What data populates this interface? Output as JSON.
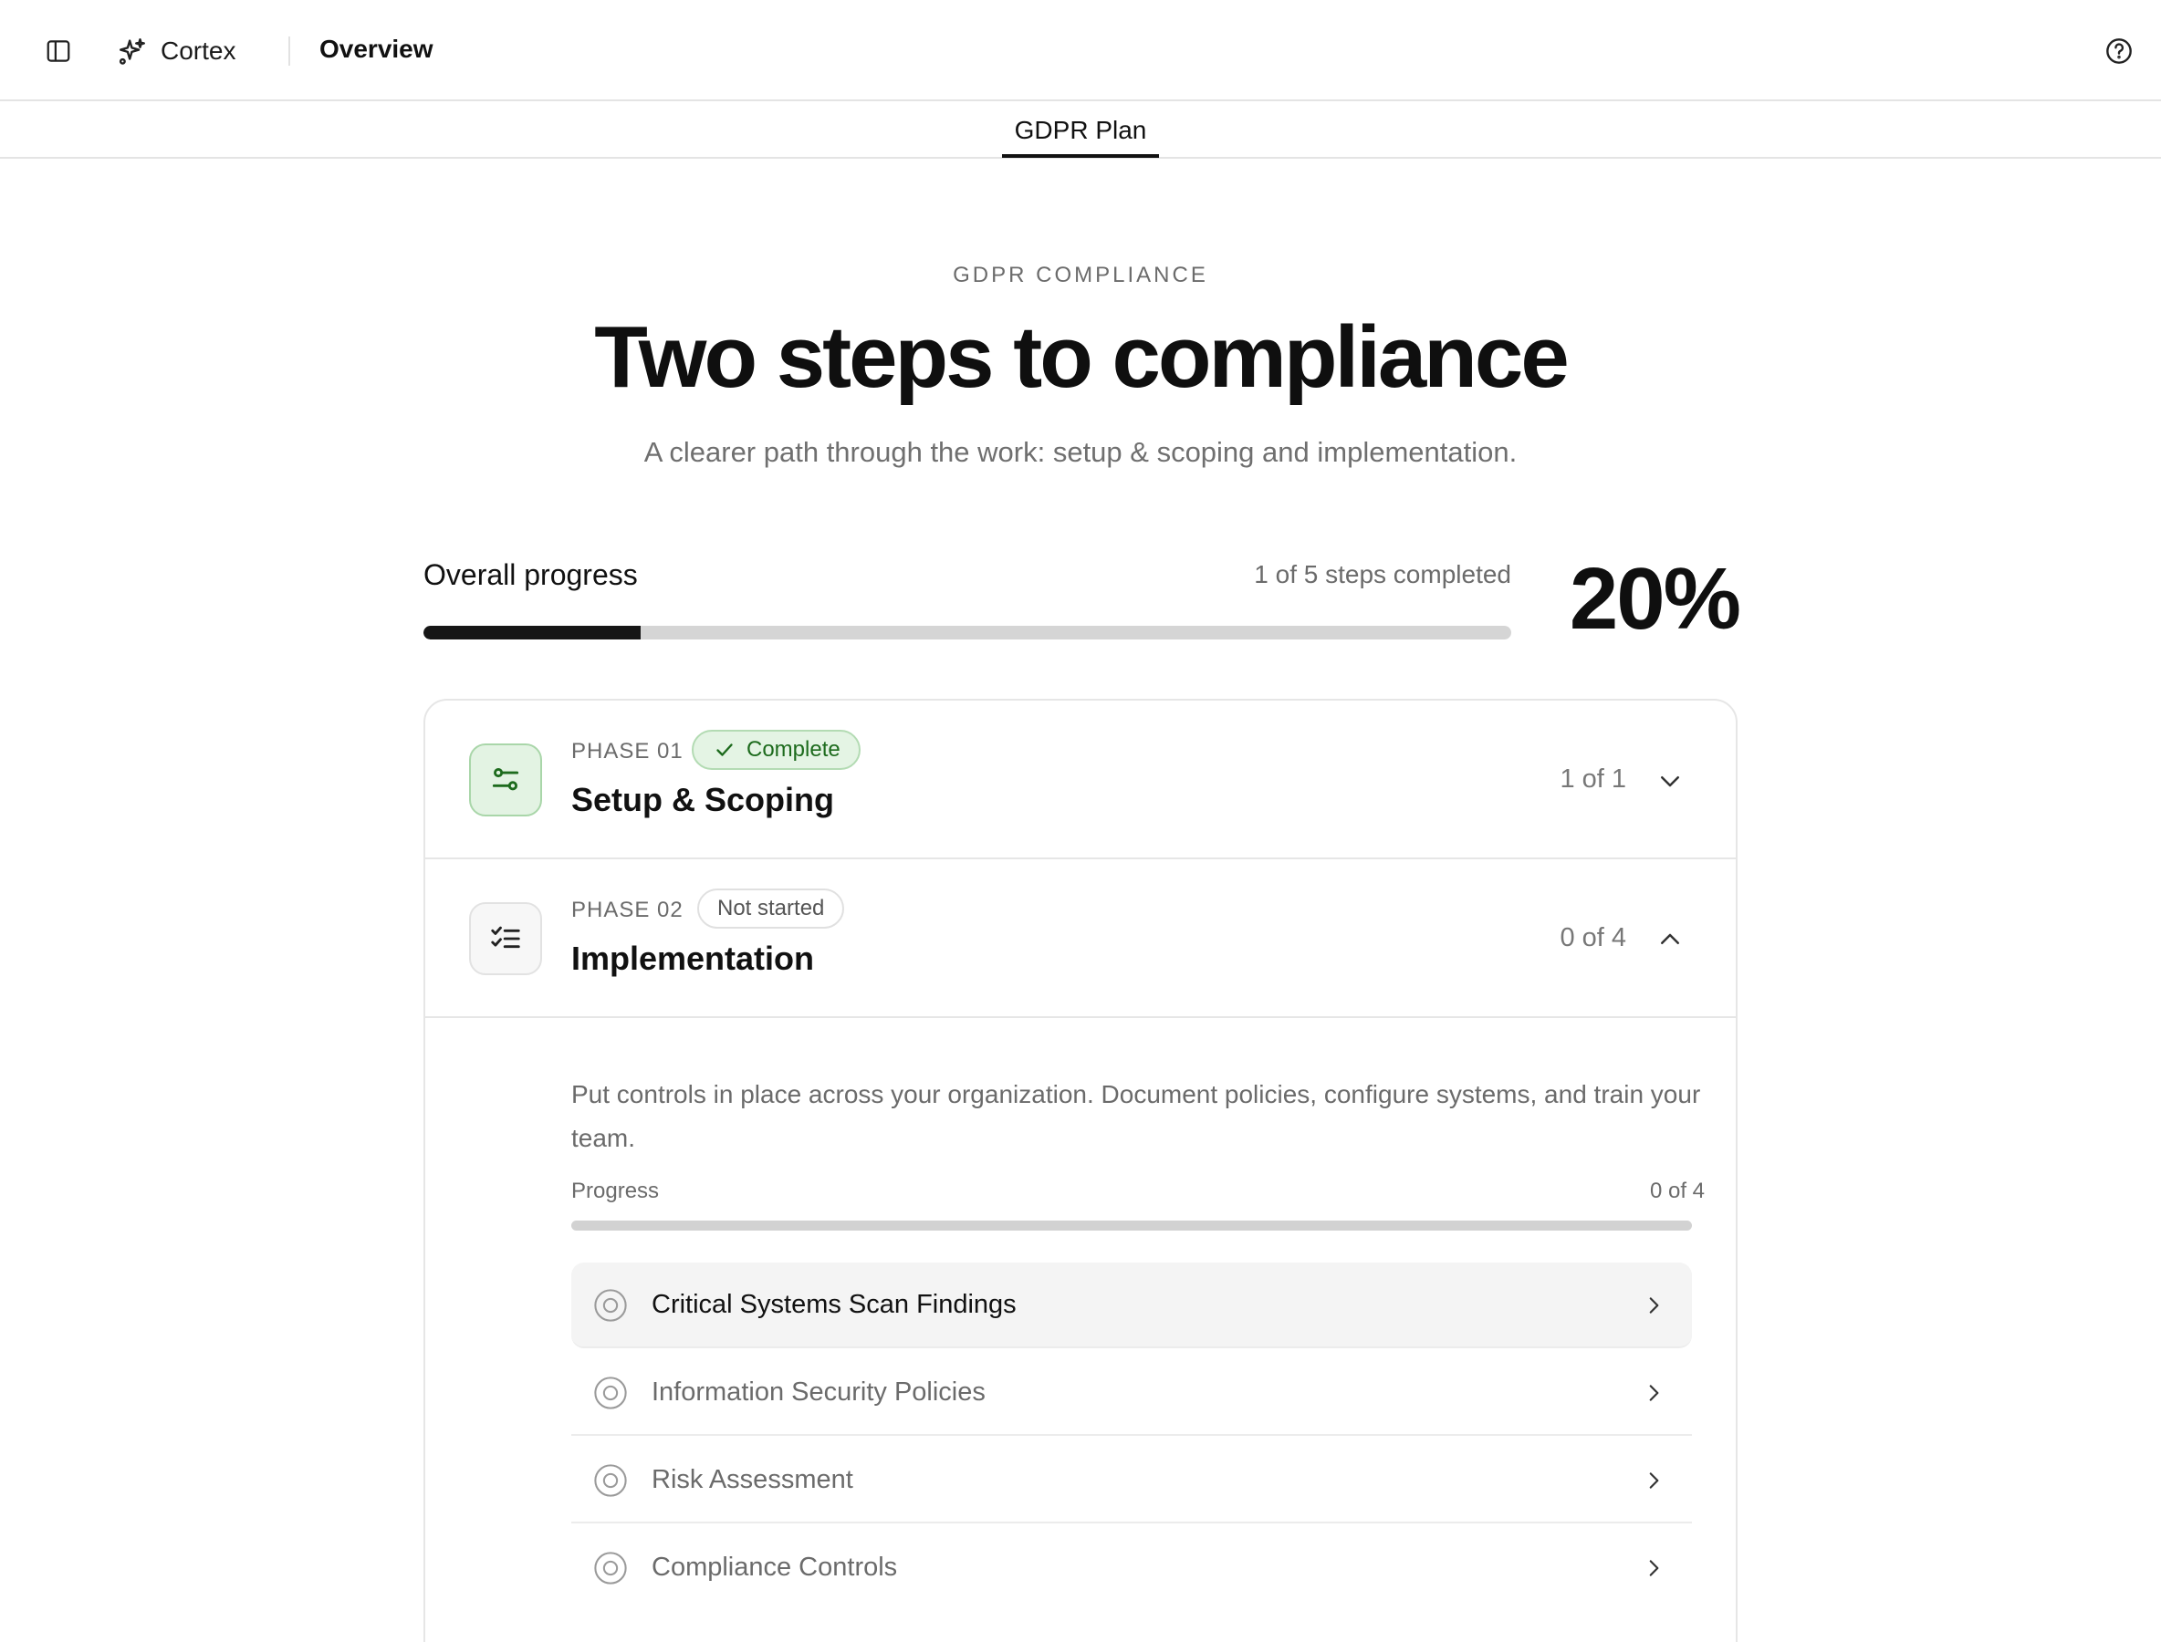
{
  "topbar": {
    "sidebar_toggle_icon": "sidebar-panel-icon",
    "brand_icon": "sparkles-icon",
    "brand_name": "Cortex",
    "title": "Overview",
    "help_icon": "help-circle-icon"
  },
  "tabs": [
    {
      "label": "GDPR Plan",
      "active": true
    }
  ],
  "hero": {
    "eyebrow": "GDPR COMPLIANCE",
    "headline": "Two steps to compliance",
    "subhead": "A clearer path through the work: setup & scoping and implementation."
  },
  "overall_progress": {
    "label": "Overall progress",
    "steps_text": "1 of 5 steps completed",
    "percent_text": "20%",
    "fraction": 0.2
  },
  "phases": [
    {
      "number": "PHASE 01",
      "status": "Complete",
      "title": "Setup & Scoping",
      "count": "1 of 1",
      "expanded": false,
      "icon": "sliders-icon",
      "chevron": "chevron-down-icon"
    },
    {
      "number": "PHASE 02",
      "status": "Not started",
      "title": "Implementation",
      "count": "0 of 4",
      "expanded": true,
      "icon": "checklist-icon",
      "chevron": "chevron-up-icon",
      "description": "Put controls in place across your organization. Document policies, configure systems, and train your team.",
      "progress_label": "Progress",
      "progress_count": "0 of 4",
      "progress_fraction": 0,
      "tasks": [
        {
          "label": "Critical Systems Scan Findings",
          "active": true
        },
        {
          "label": "Information Security Policies",
          "active": false
        },
        {
          "label": "Risk Assessment",
          "active": false
        },
        {
          "label": "Compliance Controls",
          "active": false
        }
      ]
    }
  ],
  "colors": {
    "accent_dark": "#161616",
    "complete_green": "#1d6b1d",
    "complete_bg": "#e4f4e4",
    "muted_text": "#6b6b6b"
  }
}
